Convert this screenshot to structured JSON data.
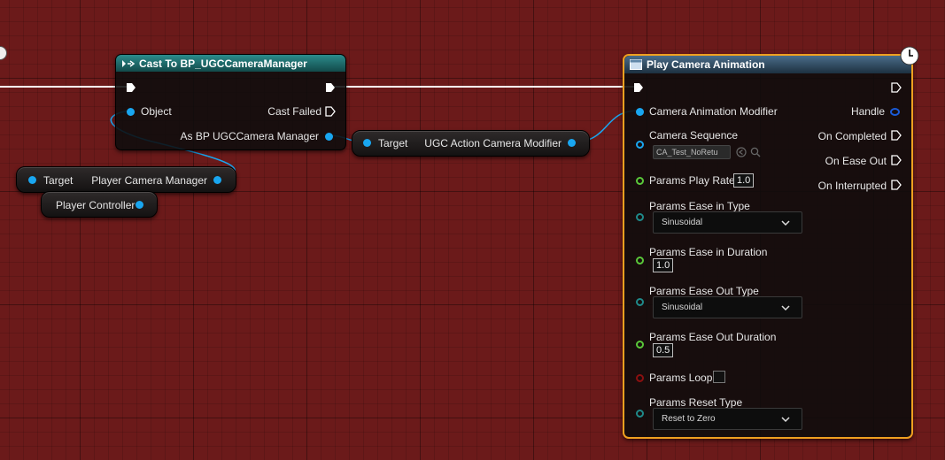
{
  "cast_node": {
    "title": "Cast To BP_UGCCameraManager",
    "object_label": "Object",
    "cast_failed_label": "Cast Failed",
    "as_label": "As BP UGCCamera Manager"
  },
  "get_modifier_node": {
    "target_label": "Target",
    "output_label": "UGC Action Camera Modifier"
  },
  "camera_manager_node": {
    "target_label": "Target",
    "output_label": "Player Camera Manager"
  },
  "player_controller_node": {
    "label": "Player Controller"
  },
  "play_node": {
    "title": "Play Camera Animation",
    "camera_animation_modifier_label": "Camera Animation Modifier",
    "handle_label": "Handle",
    "camera_sequence_label": "Camera Sequence",
    "camera_sequence_value": "CA_Test_NoRetu",
    "on_completed_label": "On Completed",
    "on_ease_out_label": "On Ease Out",
    "on_interrupted_label": "On Interrupted",
    "play_rate_label": "Params Play Rate",
    "play_rate_value": "1.0",
    "ease_in_type_label": "Params Ease in Type",
    "ease_in_type_value": "Sinusoidal",
    "ease_in_duration_label": "Params Ease in Duration",
    "ease_in_duration_value": "1.0",
    "ease_out_type_label": "Params Ease Out Type",
    "ease_out_type_value": "Sinusoidal",
    "ease_out_duration_label": "Params Ease Out Duration",
    "ease_out_duration_value": "0.5",
    "loop_label": "Params Loop",
    "loop_checked": false,
    "reset_type_label": "Params Reset Type",
    "reset_type_value": "Reset to Zero"
  },
  "colors": {
    "graph_background": "#6b1a1a",
    "cast_header": "#1c6b6b",
    "play_header": "#2d4c66",
    "selection_outline": "#f0a020",
    "object_pin": "#19a6f0",
    "exec_wire": "#ffffff"
  },
  "icons": [
    "exec-pin-icon",
    "cast-icon",
    "function-icon",
    "clock-icon",
    "chevron-down-icon",
    "browse-arrow-icon",
    "magnifier-icon"
  ]
}
